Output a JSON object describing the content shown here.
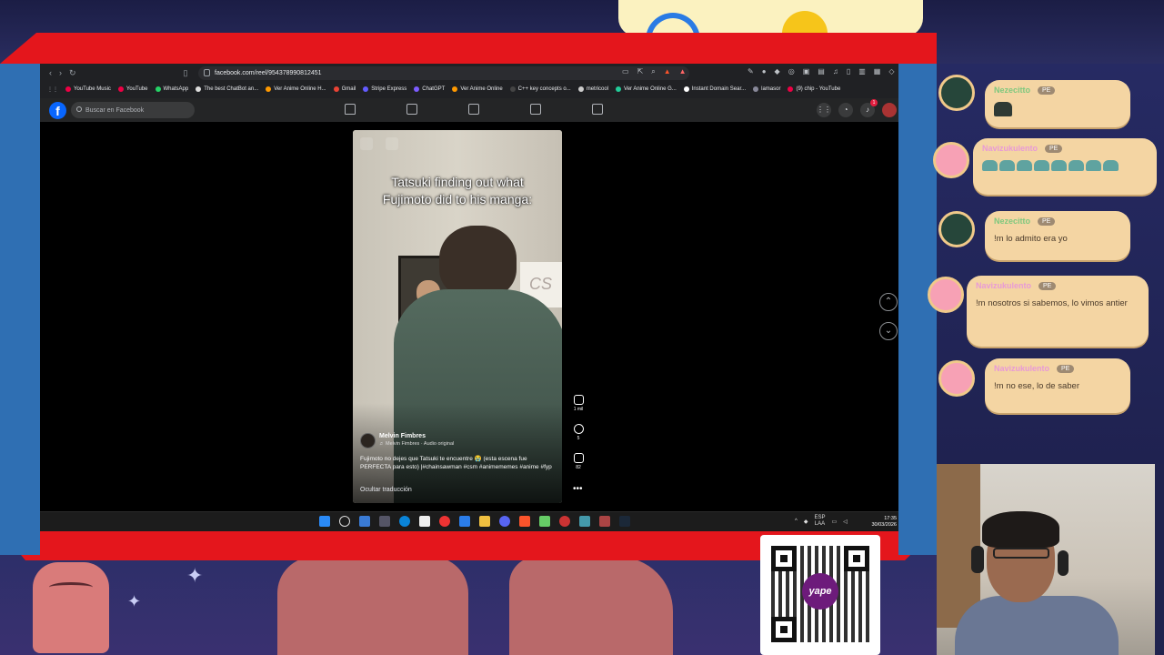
{
  "browser": {
    "url": "facebook.com/reel/954378990812451",
    "bookmarks": [
      {
        "label": "YouTube Music"
      },
      {
        "label": "YouTube"
      },
      {
        "label": "WhatsApp"
      },
      {
        "label": "The best ChatBot an..."
      },
      {
        "label": "Ver Anime Online H..."
      },
      {
        "label": "Gmail"
      },
      {
        "label": "Stripe Express"
      },
      {
        "label": "ChatGPT"
      },
      {
        "label": "Ver Anime Online"
      },
      {
        "label": "C++ key concepts o..."
      },
      {
        "label": "metricool"
      },
      {
        "label": "Ver Anime Online G..."
      },
      {
        "label": "Instant Domain Sear..."
      },
      {
        "label": "lamasor"
      },
      {
        "label": "(9) chip - YouTube"
      }
    ]
  },
  "facebook": {
    "logo": "f",
    "search_placeholder": "Buscar en Facebook",
    "notification_count": "1"
  },
  "reel": {
    "caption_line1": "Tatsuki finding out what",
    "caption_line2": "Fujimoto did to his manga:",
    "paper_text": "CS",
    "author_name": "Melvin Fimbres",
    "audio": "♬ Melvin Fimbres · Audio original",
    "description": "Fujimoto no dejes que Tatsuki te encuentre 😭 (esta escena fue PERFECTA para esto) |#chainsawman #csm #animememes #anime #fyp",
    "hide_translation": "Ocultar traducción",
    "likes": "1 mil",
    "comments": "5",
    "shares": "82",
    "more": "•••"
  },
  "taskbar": {
    "lang_line1": "ESP",
    "lang_line2": "LAA",
    "time": "17:35",
    "date": "30/03/2026"
  },
  "chat": {
    "messages": [
      {
        "user": "Nezecitto",
        "badge": "PE",
        "text": ""
      },
      {
        "user": "Navizukulento",
        "badge": "PE",
        "text": ""
      },
      {
        "user": "Nezecitto",
        "badge": "PE",
        "text": "!m lo admito era yo"
      },
      {
        "user": "Navizukulento",
        "badge": "PE",
        "text": "!m nosotros si sabemos, lo vimos antier"
      },
      {
        "user": "Navizukulento",
        "badge": "PE",
        "text": "!m no ese, lo de saber"
      }
    ]
  },
  "qr": {
    "brand": "yape"
  },
  "colors": {
    "red_frame": "#e4161c",
    "blue_frame": "#2f6fb3",
    "chat_bubble": "#f4d5a3",
    "facebook_blue": "#0866ff"
  }
}
